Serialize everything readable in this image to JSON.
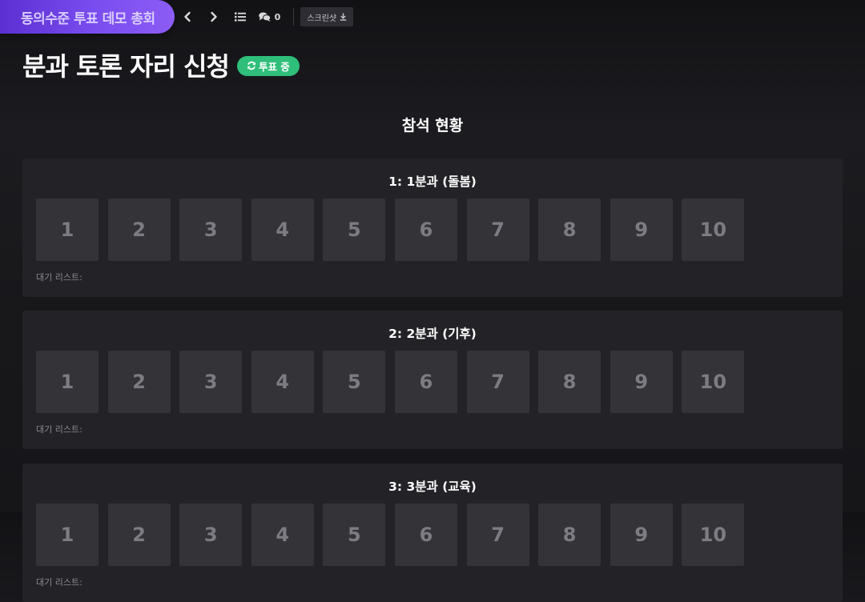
{
  "topbar": {
    "brand": "동의수준 투표 데모 총회",
    "comment_count": "0",
    "screenshot_label": "스크린샷"
  },
  "page": {
    "title": "분과 토론 자리 신청",
    "status_badge": "투표 중",
    "section_heading": "참석 현황"
  },
  "colors": {
    "brand_gradient_start": "#5b2fd1",
    "brand_gradient_end": "#8c5cf5",
    "status_green": "#2fbf7a",
    "panel_bg": "#232327",
    "seat_bg": "#333338"
  },
  "groups": [
    {
      "title": "1: 1분과 (돌봄)",
      "seats": [
        "1",
        "2",
        "3",
        "4",
        "5",
        "6",
        "7",
        "8",
        "9",
        "10"
      ],
      "waitlist_label": "대기 리스트:"
    },
    {
      "title": "2: 2분과 (기후)",
      "seats": [
        "1",
        "2",
        "3",
        "4",
        "5",
        "6",
        "7",
        "8",
        "9",
        "10"
      ],
      "waitlist_label": "대기 리스트:"
    },
    {
      "title": "3: 3분과 (교육)",
      "seats": [
        "1",
        "2",
        "3",
        "4",
        "5",
        "6",
        "7",
        "8",
        "9",
        "10"
      ],
      "waitlist_label": "대기 리스트:"
    }
  ],
  "icons": {
    "prev": "chevron-left-icon",
    "next": "chevron-right-icon",
    "list": "list-icon",
    "comments": "comments-icon",
    "download": "download-icon",
    "refresh": "refresh-icon"
  }
}
